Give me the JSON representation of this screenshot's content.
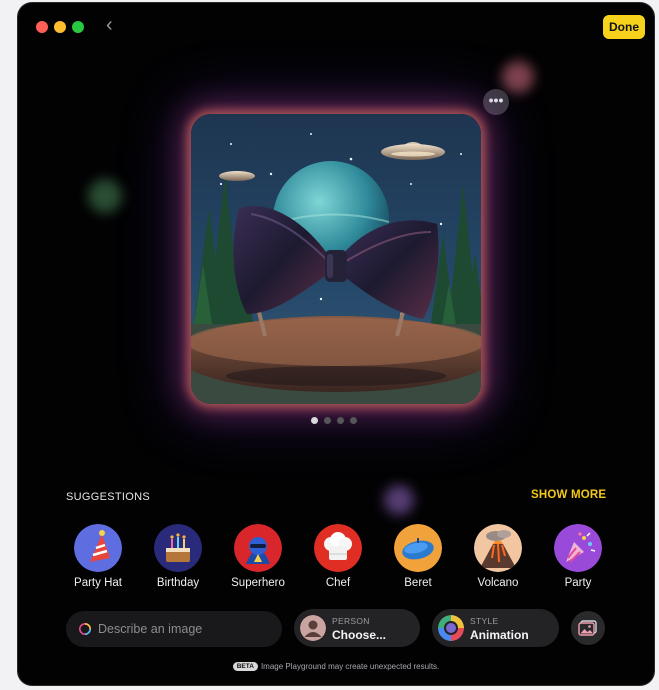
{
  "toolbar": {
    "done_label": "Done",
    "back_glyph": "‹",
    "more_glyph": "•••"
  },
  "window": {
    "traffic_lights": [
      "#ff5f57",
      "#febc2e",
      "#28c840"
    ]
  },
  "preview": {
    "page_count": 4,
    "current_page": 1
  },
  "suggestions": {
    "title": "SUGGESTIONS",
    "show_more": "SHOW MORE",
    "items": [
      {
        "label": "Party Hat",
        "icon": "party-hat-icon"
      },
      {
        "label": "Birthday",
        "icon": "birthday-cake-icon"
      },
      {
        "label": "Superhero",
        "icon": "superhero-icon"
      },
      {
        "label": "Chef",
        "icon": "chef-hat-icon"
      },
      {
        "label": "Beret",
        "icon": "beret-icon"
      },
      {
        "label": "Volcano",
        "icon": "volcano-icon"
      },
      {
        "label": "Party",
        "icon": "party-popper-icon"
      }
    ]
  },
  "input": {
    "placeholder": "Describe an image"
  },
  "person": {
    "caption": "PERSON",
    "value": "Choose..."
  },
  "style": {
    "caption": "STYLE",
    "value": "Animation"
  },
  "footer": {
    "badge": "BETA",
    "text": "Image Playground may create unexpected results."
  },
  "colors": {
    "accent": "#f7d21c",
    "background": "#020203"
  }
}
